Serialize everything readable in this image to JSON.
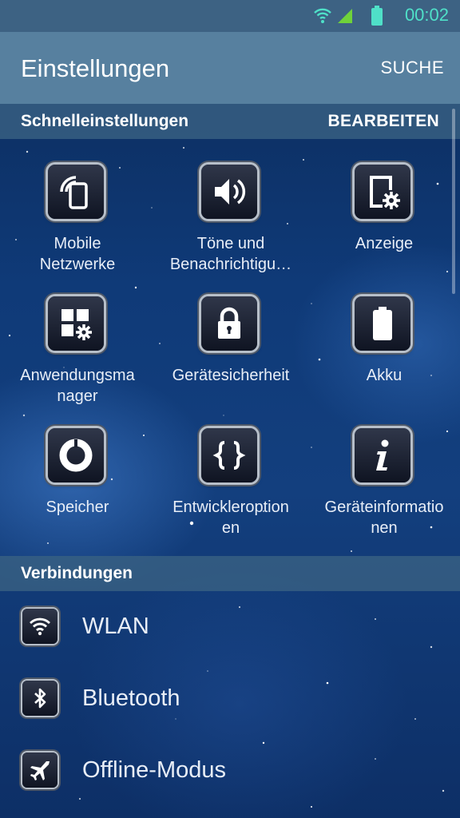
{
  "status_bar": {
    "time": "00:02",
    "icons": [
      "wifi-icon",
      "signal-icon",
      "battery-icon"
    ],
    "accent": "#4fe0c8"
  },
  "header": {
    "title": "Einstellungen",
    "search_label": "SUCHE"
  },
  "quick_settings": {
    "title": "Schnelleinstellungen",
    "edit_label": "BEARBEITEN",
    "items": [
      {
        "label": "Mobile\nNetzwerke",
        "icon": "mobile-networks-icon"
      },
      {
        "label": "Töne und\nBenachrichtigu…",
        "icon": "volume-icon"
      },
      {
        "label": "Anzeige",
        "icon": "display-icon"
      },
      {
        "label": "Anwendungsma\nnager",
        "icon": "app-manager-icon"
      },
      {
        "label": "Gerätesicherheit",
        "icon": "lock-icon"
      },
      {
        "label": "Akku",
        "icon": "battery-icon"
      },
      {
        "label": "Speicher",
        "icon": "storage-icon"
      },
      {
        "label": "Entwickleroption\nen",
        "icon": "developer-options-icon"
      },
      {
        "label": "Geräteinformatio\nnen",
        "icon": "info-icon"
      }
    ]
  },
  "connections": {
    "title": "Verbindungen",
    "items": [
      {
        "label": "WLAN",
        "icon": "wifi-icon"
      },
      {
        "label": "Bluetooth",
        "icon": "bluetooth-icon"
      },
      {
        "label": "Offline-Modus",
        "icon": "airplane-icon"
      }
    ]
  },
  "colors": {
    "status_bar_bg": "#3d6283",
    "action_bar_bg": "#57809f",
    "section_header_bg": "#386082",
    "background": "#0f3a78"
  }
}
